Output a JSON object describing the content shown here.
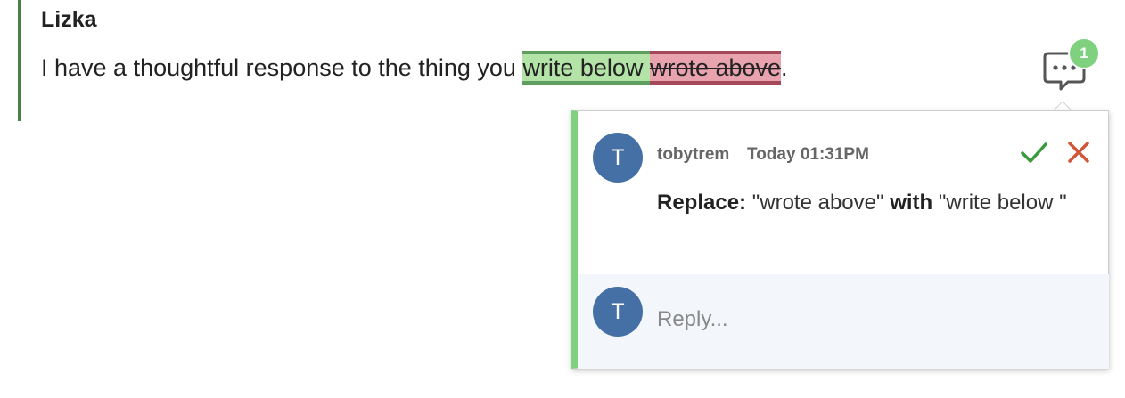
{
  "quote": {
    "author": "Lizka",
    "text_before": "I have a thoughtful response to the thing you ",
    "inserted": "write below ",
    "deleted": "wrote above",
    "text_after": "."
  },
  "comment_indicator": {
    "icon": "comment-dots-icon",
    "count": "1"
  },
  "comment": {
    "avatar_initial": "T",
    "username": "tobytrem",
    "timestamp": "Today 01:31PM",
    "accept_icon": "checkmark-icon",
    "reject_icon": "close-icon",
    "replace_label": "Replace:",
    "old_text": "\"wrote above\"",
    "with_label": "with",
    "new_text": "\"write below \""
  },
  "reply": {
    "avatar_initial": "T",
    "placeholder": "Reply..."
  },
  "colors": {
    "accent_green": "#7fd17f",
    "insert_bg": "#b4e3a8",
    "delete_bg": "#e9a3ae",
    "avatar_blue": "#4470a6",
    "accept_green": "#3c9a3c",
    "reject_red": "#d2553a"
  }
}
